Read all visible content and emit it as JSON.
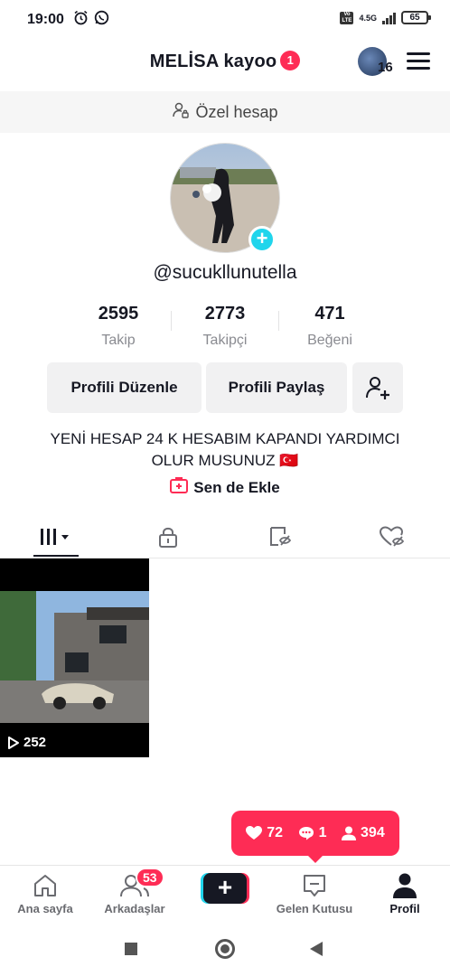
{
  "status_bar": {
    "time": "19:00",
    "network": "4.5G",
    "battery": "65"
  },
  "header": {
    "title": "MELİSA kayoo",
    "notification_count": "1",
    "avatar_count": "16"
  },
  "private_banner": {
    "label": "Özel hesap"
  },
  "profile": {
    "username": "@sucukllunutella",
    "stats": [
      {
        "value": "2595",
        "label": "Takip"
      },
      {
        "value": "2773",
        "label": "Takipçi"
      },
      {
        "value": "471",
        "label": "Beğeni"
      }
    ],
    "buttons": {
      "edit": "Profili Düzenle",
      "share": "Profili Paylaş"
    },
    "bio": "YENİ HESAP 24 K HESABIM KAPANDI YARDIMCI OLUR MUSUNUZ 🇹🇷",
    "add_link": "Sen de Ekle"
  },
  "videos": [
    {
      "views": "252"
    }
  ],
  "notification": {
    "likes": "72",
    "comments": "1",
    "followers": "394"
  },
  "bottom_nav": {
    "home": "Ana sayfa",
    "friends": "Arkadaşlar",
    "friends_badge": "53",
    "create": "+",
    "inbox": "Gelen Kutusu",
    "profile": "Profil"
  },
  "icons": {
    "alarm": "alarm-icon",
    "whatsapp": "whatsapp-icon",
    "menu": "menu-icon",
    "grid": "grid-icon",
    "lock": "lock-icon",
    "tagged": "tagged-icon",
    "liked": "liked-icon"
  }
}
